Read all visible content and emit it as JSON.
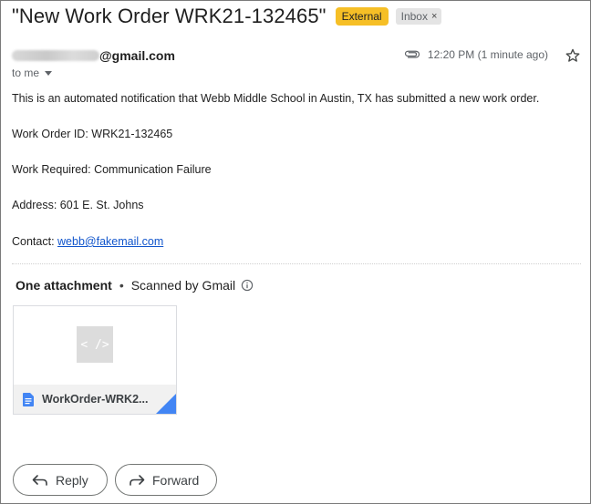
{
  "email": {
    "subject": "\"New Work Order WRK21-132465\"",
    "labels": {
      "external": "External",
      "inbox": "Inbox",
      "inbox_remove": "×"
    },
    "sender": {
      "email_suffix": "@gmail.com"
    },
    "recipient": "to me",
    "timestamp": "12:20 PM (1 minute ago)",
    "body": {
      "intro": "This is an automated notification that Webb Middle School in Austin, TX has submitted a new work order.",
      "work_order_id": "Work Order ID: WRK21-132465",
      "work_required": "Work Required: Communication Failure",
      "address": "Address: 601 E. St. Johns",
      "contact_label": "Contact: ",
      "contact_email": "webb@fakemail.com"
    }
  },
  "attachments": {
    "title": "One attachment",
    "separator": "•",
    "scanned": "Scanned by Gmail",
    "items": [
      {
        "preview_glyph": "< />",
        "name": "WorkOrder-WRK2..."
      }
    ]
  },
  "actions": {
    "reply": "Reply",
    "forward": "Forward"
  },
  "colors": {
    "external_badge": "#f6bf26",
    "link": "#1155cc",
    "doc_icon": "#4285f4"
  },
  "icons": [
    "paperclip-icon",
    "star-icon",
    "chevron-down-icon",
    "info-icon",
    "code-icon",
    "doc-icon",
    "reply-icon",
    "forward-icon"
  ]
}
